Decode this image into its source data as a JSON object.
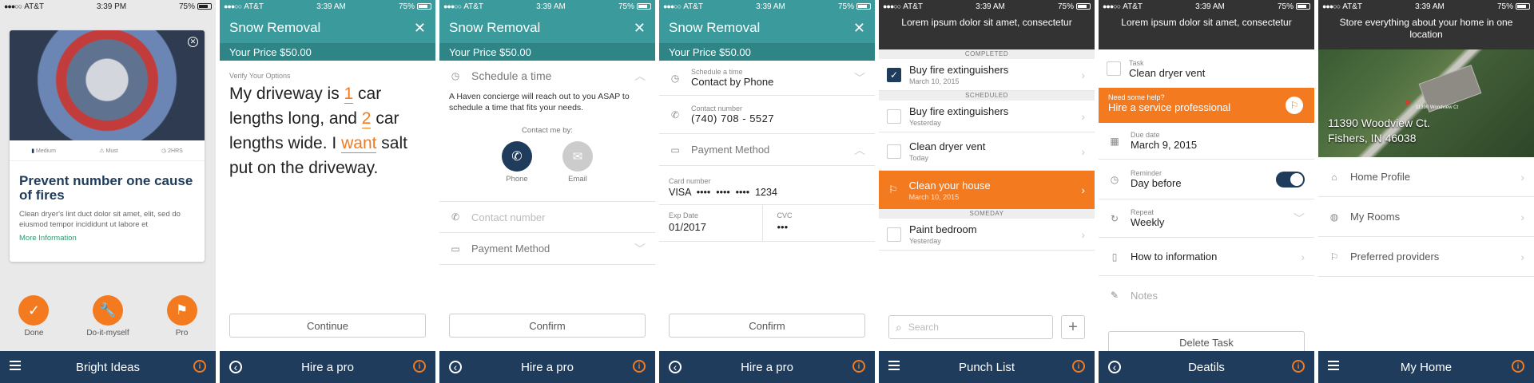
{
  "status": {
    "carrier": "AT&T",
    "time": "3:39 PM",
    "time_am": "3:39 AM",
    "battery": "75%"
  },
  "s1": {
    "card_title": "Prevent number one cause of fires",
    "card_body": "Clean dryer's lint duct dolor sit amet, elit, sed do eiusmod tempor incididunt ut labore et",
    "more": "More Information",
    "meta": [
      "Medium",
      "Must",
      "2HRS"
    ],
    "actions": [
      "Done",
      "Do-it-myself",
      "Pro"
    ],
    "nav_title": "Bright Ideas"
  },
  "s2": {
    "title": "Snow Removal",
    "price": "Your Price $50.00",
    "verify": "Verify Your Options",
    "p1": "My driveway is ",
    "n1": "1",
    "p2": " car lengths long, and ",
    "n2": "2",
    "p3": " car lengths wide. I ",
    "w": "want",
    "p4": " salt put on the driveway.",
    "button": "Continue",
    "nav_title": "Hire a pro"
  },
  "s3": {
    "title": "Snow Removal",
    "price": "Your Price $50.00",
    "schedule": "Schedule a time",
    "desc": "A Haven concierge will reach out to you ASAP to schedule a time that fits your needs.",
    "contact_by": "Contact me by:",
    "phone": "Phone",
    "email": "Email",
    "contact_placeholder": "Contact number",
    "payment": "Payment Method",
    "button": "Confirm",
    "nav_title": "Hire a pro"
  },
  "s4": {
    "title": "Snow Removal",
    "price": "Your Price $50.00",
    "schedule_label": "Schedule a time",
    "schedule_value": "Contact by Phone",
    "contact_label": "Contact number",
    "contact_value": "(740) 708 - 5527",
    "payment": "Payment Method",
    "card_label": "Card number",
    "card_value": "VISA  ••••  ••••  ••••  1234",
    "exp_label": "Exp Date",
    "exp_value": "01/2017",
    "cvc_label": "CVC",
    "cvc_value": "•••",
    "button": "Confirm",
    "nav_title": "Hire a pro"
  },
  "s5": {
    "header": "Lorem ipsum dolor sit amet, consectetur",
    "sections": [
      "COMPLETED",
      "SCHEDULED",
      "SOMEDAY"
    ],
    "completed": [
      {
        "title": "Buy fire extinguishers",
        "sub": "March 10, 2015"
      }
    ],
    "scheduled": [
      {
        "title": "Buy fire extinguishers",
        "sub": "Yesterday"
      },
      {
        "title": "Clean dryer vent",
        "sub": "Today"
      },
      {
        "title": "Clean your house",
        "sub": "March 10, 2015"
      }
    ],
    "someday": [
      {
        "title": "Paint bedroom",
        "sub": "Yesterday"
      }
    ],
    "search_placeholder": "Search",
    "nav_title": "Punch List"
  },
  "s6": {
    "header": "Lorem ipsum dolor sit amet, consectetur",
    "task_label": "Task",
    "task_value": "Clean dryer vent",
    "help_label": "Need some help?",
    "help_value": "Hire a service professional",
    "due_label": "Due date",
    "due_value": "March 9, 2015",
    "reminder_label": "Reminder",
    "reminder_value": "Day before",
    "repeat_label": "Repeat",
    "repeat_value": "Weekly",
    "howto": "How to information",
    "notes": "Notes",
    "delete": "Delete Task",
    "nav_title": "Deatils"
  },
  "s7": {
    "header": "Store everything about your home in one location",
    "addr1": "11390 Woodview Ct.",
    "addr2": "Fishers, IN 46038",
    "map_label": "11390 Woodview Ct",
    "items": [
      "Home Profile",
      "My Rooms",
      "Preferred providers"
    ],
    "nav_title": "My Home"
  },
  "colors": {
    "teal": "#3b9b9c",
    "navy": "#1f3c5c",
    "orange": "#f47a1f",
    "dark": "#333333"
  }
}
